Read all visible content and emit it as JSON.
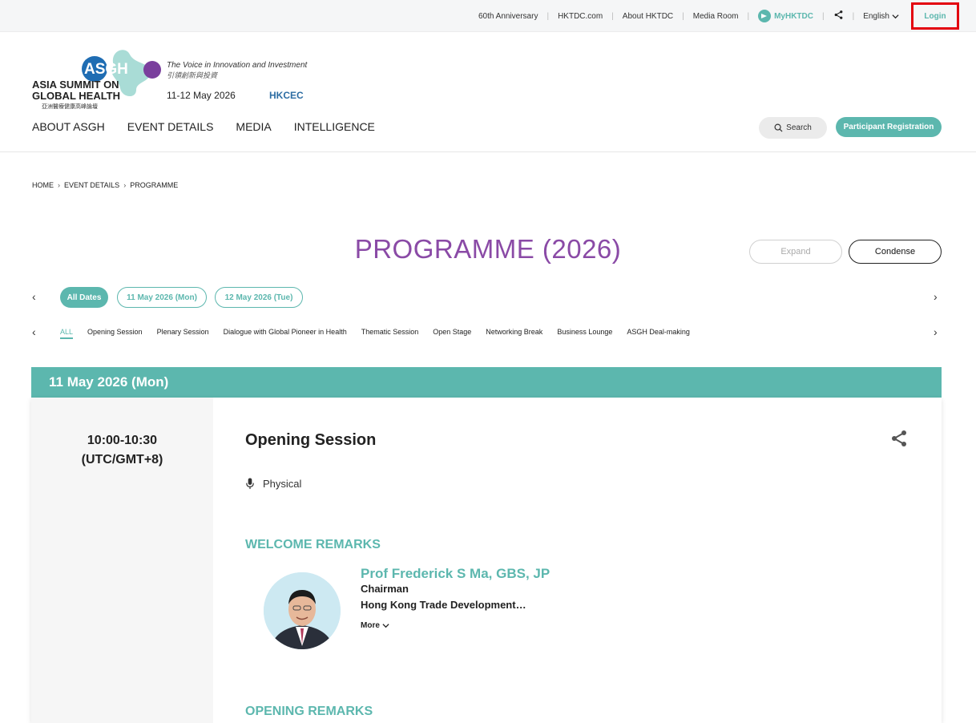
{
  "topbar": {
    "links": [
      "60th Anniversary",
      "HKTDC.com",
      "About HKTDC",
      "Media Room"
    ],
    "my_hktdc": "MyHKTDC",
    "language": "English",
    "login": "Login"
  },
  "header": {
    "logo_mark": "ASGH",
    "logo_title_line1": "ASIA SUMMIT ON",
    "logo_title_line2": "GLOBAL HEALTH",
    "logo_subtitle_zh": "亞洲醫療健康高峰論壇",
    "tagline": "The Voice in Innovation and Investment",
    "tagline_zh": "引領創新與投資",
    "dates": "11-12 May 2026",
    "venue": "HKCEC",
    "nav": [
      "ABOUT ASGH",
      "EVENT DETAILS",
      "MEDIA",
      "INTELLIGENCE"
    ],
    "search_label": "Search",
    "register_label": "Participant Registration"
  },
  "breadcrumb": [
    "HOME",
    "EVENT DETAILS",
    "PROGRAMME"
  ],
  "page": {
    "title": "PROGRAMME (2026)",
    "expand_label": "Expand",
    "condense_label": "Condense"
  },
  "date_filters": [
    "All Dates",
    "11 May 2026 (Mon)",
    "12 May 2026 (Tue)"
  ],
  "categories": [
    "ALL",
    "Opening Session",
    "Plenary Session",
    "Dialogue with Global Pioneer in Health",
    "Thematic Session",
    "Open Stage",
    "Networking Break",
    "Business Lounge",
    "ASGH Deal-making"
  ],
  "day": {
    "label": "11 May 2026 (Mon)"
  },
  "session": {
    "time": "10:00-10:30",
    "timezone": "(UTC/GMT+8)",
    "title": "Opening Session",
    "format": "Physical",
    "section1": "WELCOME REMARKS",
    "speaker": {
      "name": "Prof Frederick S Ma, GBS, JP",
      "role": "Chairman",
      "org": "Hong Kong Trade Development…",
      "more": "More"
    },
    "section2": "OPENING REMARKS"
  },
  "colors": {
    "accent": "#5cb7ae",
    "title_purple": "#8a4aa6",
    "login_highlight": "#e3000f"
  }
}
